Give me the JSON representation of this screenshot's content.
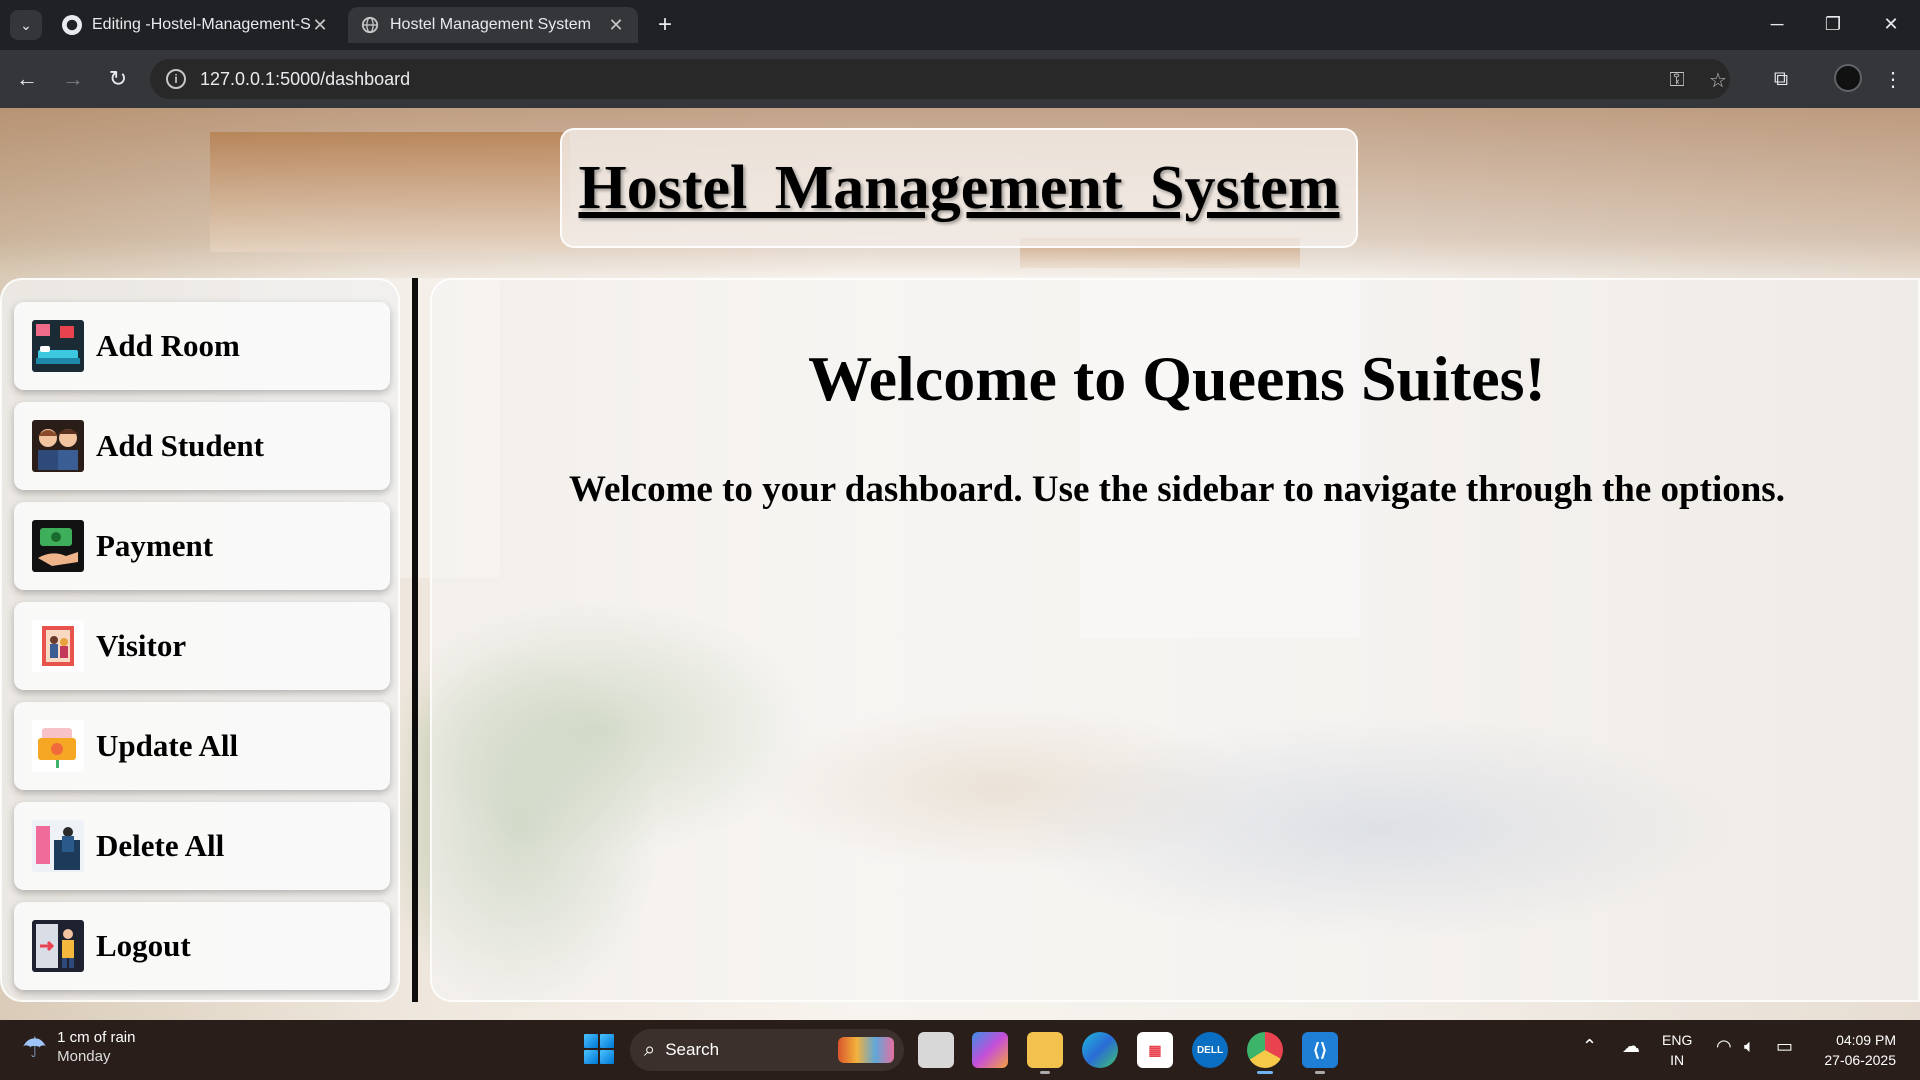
{
  "browser": {
    "tabs": [
      {
        "title": "Editing -Hostel-Management-S",
        "active": false,
        "icon": "github-icon"
      },
      {
        "title": "Hostel Management System",
        "active": true,
        "icon": "globe-icon"
      }
    ],
    "url": "127.0.0.1:5000/dashboard"
  },
  "page": {
    "header_title": "Hostel Management System",
    "welcome_heading": "Welcome to Queens Suites!",
    "welcome_text": "Welcome to your dashboard. Use the sidebar to navigate through the options."
  },
  "sidebar": {
    "items": [
      {
        "label": "Add Room",
        "icon": "room-bed-icon"
      },
      {
        "label": "Add Student",
        "icon": "students-icon"
      },
      {
        "label": "Payment",
        "icon": "payment-hand-icon"
      },
      {
        "label": "Visitor",
        "icon": "visitor-icon"
      },
      {
        "label": "Update All",
        "icon": "update-folder-icon"
      },
      {
        "label": "Delete All",
        "icon": "delete-bin-icon"
      },
      {
        "label": "Logout",
        "icon": "logout-door-icon"
      }
    ]
  },
  "taskbar": {
    "weather_line1": "1 cm of rain",
    "weather_line2": "Monday",
    "search_label": "Search",
    "lang_line1": "ENG",
    "lang_line2": "IN",
    "time": "04:09 PM",
    "date": "27-06-2025"
  }
}
